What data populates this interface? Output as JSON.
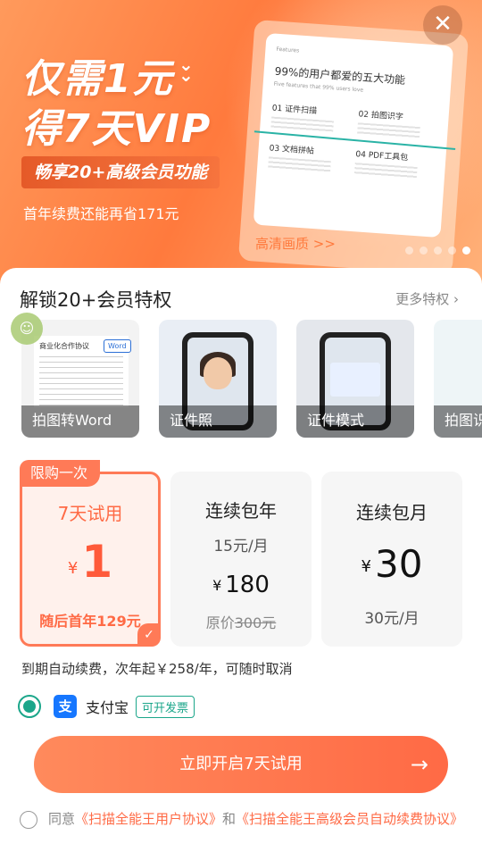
{
  "banner": {
    "headline_line1": "仅需1元",
    "headline_line2": "得7天VIP",
    "pill": "畅享20+高级会员功能",
    "save_text": "首年续费还能再省171元",
    "preview": {
      "small_top": "Features",
      "title": "99%的用户都爱的五大功能",
      "subtitle": "Five features that 99% users love",
      "items": [
        "01 证件扫描",
        "02 拍图识字",
        "03 文档拼帖",
        "04 PDF工具包"
      ]
    },
    "hd_label": "高清画质 >>",
    "dots_total": 5,
    "dots_active": 5
  },
  "section": {
    "title": "解锁20+会员特权",
    "more": "更多特权"
  },
  "features": [
    {
      "label": "拍图转Word",
      "doc_title": "商业化合作协议",
      "badge": "Word"
    },
    {
      "label": "证件照"
    },
    {
      "label": "证件模式"
    },
    {
      "label": "拍图识"
    }
  ],
  "plans": {
    "p1": {
      "tag": "限购一次",
      "name": "7天试用",
      "currency": "¥",
      "price": "1",
      "after": "随后首年129元"
    },
    "p2": {
      "name": "连续包年",
      "per": "15元/月",
      "currency": "¥",
      "price": "180",
      "orig_prefix": "原价",
      "orig": "300元"
    },
    "p3": {
      "name": "连续包月",
      "currency": "¥",
      "price": "30",
      "per": "30元/月"
    }
  },
  "renew_note": "到期自动续费，次年起￥258/年，可随时取消",
  "payment": {
    "name": "支付宝",
    "icon_glyph": "支",
    "invoice": "可开发票"
  },
  "cta": {
    "label": "立即开启7天试用",
    "arrow": "→"
  },
  "agreement": {
    "prefix": "同意",
    "link1": "《扫描全能王用户协议》",
    "and": "和",
    "link2": "《扫描全能王高级会员自动续费协议》"
  },
  "colors": {
    "accent": "#ff6a45",
    "green": "#1ba68a",
    "alipay": "#1677ff"
  }
}
